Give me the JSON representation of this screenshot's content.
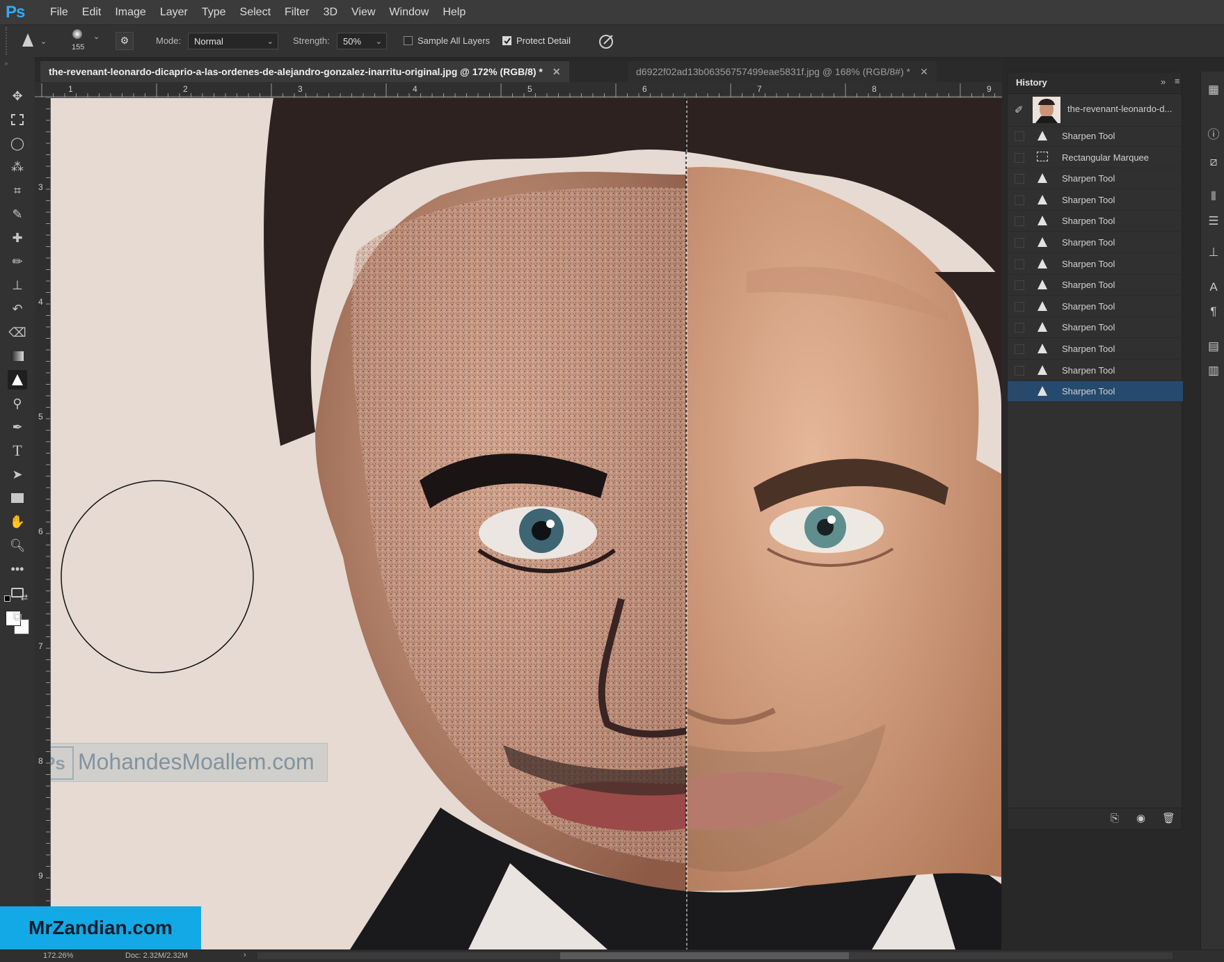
{
  "app": {
    "logo": "Ps"
  },
  "menu": [
    "File",
    "Edit",
    "Image",
    "Layer",
    "Type",
    "Select",
    "Filter",
    "3D",
    "View",
    "Window",
    "Help"
  ],
  "options": {
    "brush_size": "155",
    "mode_label": "Mode:",
    "mode_value": "Normal",
    "strength_label": "Strength:",
    "strength_value": "50%",
    "sample_all_layers_label": "Sample All Layers",
    "sample_all_layers_checked": false,
    "protect_detail_label": "Protect Detail",
    "protect_detail_checked": true
  },
  "tabs": [
    {
      "label": "the-revenant-leonardo-dicaprio-a-las-ordenes-de-alejandro-gonzalez-inarritu-original.jpg @ 172% (RGB/8) *",
      "active": true
    },
    {
      "label": "d6922f02ad13b06356757499eae5831f.jpg @ 168% (RGB/8#) *",
      "active": false
    }
  ],
  "ruler_top": [
    "1",
    "2",
    "3",
    "4",
    "5",
    "6",
    "7",
    "8",
    "9"
  ],
  "ruler_left": [
    "3",
    "4",
    "5",
    "6",
    "7",
    "8",
    "9"
  ],
  "history": {
    "title": "History",
    "snapshot": "the-revenant-leonardo-d...",
    "items": [
      {
        "label": "Sharpen Tool",
        "icon": "sharpen-icon"
      },
      {
        "label": "Rectangular Marquee",
        "icon": "marquee-icon"
      },
      {
        "label": "Sharpen Tool",
        "icon": "sharpen-icon"
      },
      {
        "label": "Sharpen Tool",
        "icon": "sharpen-icon"
      },
      {
        "label": "Sharpen Tool",
        "icon": "sharpen-icon"
      },
      {
        "label": "Sharpen Tool",
        "icon": "sharpen-icon"
      },
      {
        "label": "Sharpen Tool",
        "icon": "sharpen-icon"
      },
      {
        "label": "Sharpen Tool",
        "icon": "sharpen-icon"
      },
      {
        "label": "Sharpen Tool",
        "icon": "sharpen-icon"
      },
      {
        "label": "Sharpen Tool",
        "icon": "sharpen-icon"
      },
      {
        "label": "Sharpen Tool",
        "icon": "sharpen-icon"
      },
      {
        "label": "Sharpen Tool",
        "icon": "sharpen-icon"
      },
      {
        "label": "Sharpen Tool",
        "icon": "sharpen-icon",
        "selected": true
      }
    ]
  },
  "status": {
    "zoom": "172.26%",
    "doc": "Doc: 2.32M/2.32M"
  },
  "watermarks": {
    "site": "MohandesMoallem.com",
    "brand": "MrZandian.com"
  },
  "colors": {
    "accent": "#31a8ff",
    "selected_row": "#264a6e",
    "brand_bg": "#13a9e6"
  }
}
